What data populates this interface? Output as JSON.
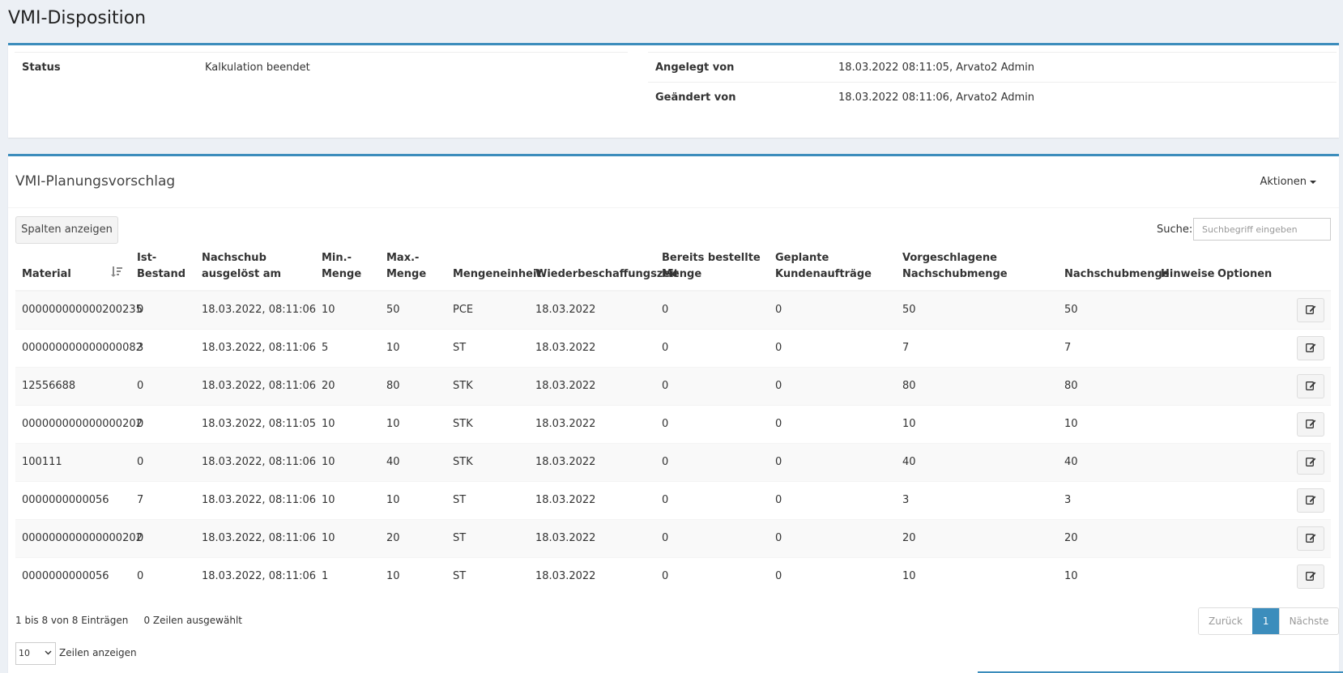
{
  "page": {
    "title": "VMI-Disposition"
  },
  "status_box": {
    "status_label": "Status",
    "status_value": "Kalkulation beendet",
    "created_label": "Angelegt von",
    "created_value": "18.03.2022 08:11:05, Arvato2 Admin",
    "changed_label": "Geändert von",
    "changed_value": "18.03.2022 08:11:06, Arvato2 Admin"
  },
  "plan_box": {
    "title": "VMI-Planungsvorschlag",
    "actions_label": "Aktionen",
    "columns_button": "Spalten anzeigen",
    "search_label": "Suche:",
    "search_placeholder": "Suchbegriff eingeben"
  },
  "table": {
    "headers": [
      "Material",
      "Ist-Bestand",
      "Nachschub ausgelöst am",
      "Min.-Menge",
      "Max.-Menge",
      "Mengeneinheit",
      "Wiederbeschaffungszeit",
      "Bereits bestellte Menge",
      "Geplante Kundenaufträge",
      "Vorgeschlagene Nachschubmenge",
      "Nachschubmenge",
      "Hinweise",
      "Optionen"
    ],
    "rows": [
      [
        "000000000000200235",
        "0",
        "18.03.2022, 08:11:06",
        "10",
        "50",
        "PCE",
        "18.03.2022",
        "0",
        "0",
        "50",
        "50",
        ""
      ],
      [
        "000000000000000082",
        "3",
        "18.03.2022, 08:11:06",
        "5",
        "10",
        "ST",
        "18.03.2022",
        "0",
        "0",
        "7",
        "7",
        ""
      ],
      [
        "12556688",
        "0",
        "18.03.2022, 08:11:06",
        "20",
        "80",
        "STK",
        "18.03.2022",
        "0",
        "0",
        "80",
        "80",
        ""
      ],
      [
        "000000000000000202",
        "0",
        "18.03.2022, 08:11:05",
        "10",
        "10",
        "STK",
        "18.03.2022",
        "0",
        "0",
        "10",
        "10",
        ""
      ],
      [
        "100111",
        "0",
        "18.03.2022, 08:11:06",
        "10",
        "40",
        "STK",
        "18.03.2022",
        "0",
        "0",
        "40",
        "40",
        ""
      ],
      [
        "0000000000056",
        "7",
        "18.03.2022, 08:11:06",
        "10",
        "10",
        "ST",
        "18.03.2022",
        "0",
        "0",
        "3",
        "3",
        ""
      ],
      [
        "000000000000000202",
        "0",
        "18.03.2022, 08:11:06",
        "10",
        "20",
        "ST",
        "18.03.2022",
        "0",
        "0",
        "20",
        "20",
        ""
      ],
      [
        "0000000000056",
        "0",
        "18.03.2022, 08:11:06",
        "1",
        "10",
        "ST",
        "18.03.2022",
        "0",
        "0",
        "10",
        "10",
        ""
      ]
    ]
  },
  "footer": {
    "entries_info": "1 bis 8 von 8 Einträgen",
    "selected_info": "0 Zeilen ausgewählt",
    "prev": "Zurück",
    "page": "1",
    "next": "Nächste",
    "length_value": "10",
    "length_label": "Zeilen anzeigen"
  },
  "colors": {
    "accent": "#3c8dbc",
    "background": "#ecf0f5"
  },
  "icons": {
    "sort": "sort-amount-down-icon",
    "edit": "edit-icon",
    "dropdown": "caret-down-icon"
  }
}
